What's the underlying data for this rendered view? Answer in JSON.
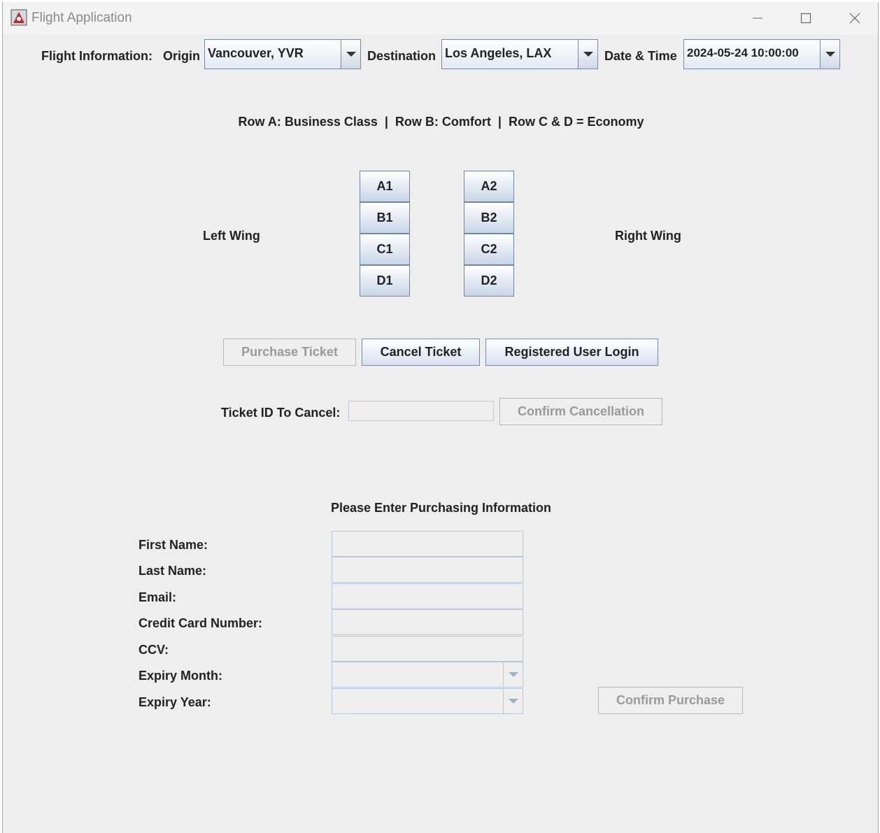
{
  "window": {
    "title": "Flight Application"
  },
  "flight_info": {
    "label": "Flight Information:",
    "origin_label": "Origin",
    "origin_value": "Vancouver, YVR",
    "destination_label": "Destination",
    "destination_value": "Los Angeles, LAX",
    "datetime_label": "Date & Time",
    "datetime_value": "2024-05-24 10:00:00"
  },
  "seat_legend": "Row A: Business Class  |  Row B: Comfort  |  Row C & D = Economy",
  "seat_map": {
    "left_wing": "Left Wing",
    "right_wing": "Right Wing",
    "left_column": [
      "A1",
      "B1",
      "C1",
      "D1"
    ],
    "right_column": [
      "A2",
      "B2",
      "C2",
      "D2"
    ]
  },
  "actions": {
    "purchase": "Purchase Ticket",
    "cancel": "Cancel Ticket",
    "login": "Registered User Login"
  },
  "cancellation": {
    "label": "Ticket ID To Cancel:",
    "value": "",
    "confirm": "Confirm Cancellation"
  },
  "purchase_form": {
    "heading": "Please Enter Purchasing Information",
    "first_name": "First Name:",
    "last_name": "Last Name:",
    "email": "Email:",
    "card_number": "Credit Card Number:",
    "ccv": "CCV:",
    "expiry_month": "Expiry Month:",
    "expiry_year": "Expiry Year:",
    "confirm": "Confirm Purchase"
  },
  "colors": {
    "window_bg": "#eeeeee",
    "button_gradient_bottom": "#d7e1ee",
    "disabled_text": "#9a9a9a"
  }
}
